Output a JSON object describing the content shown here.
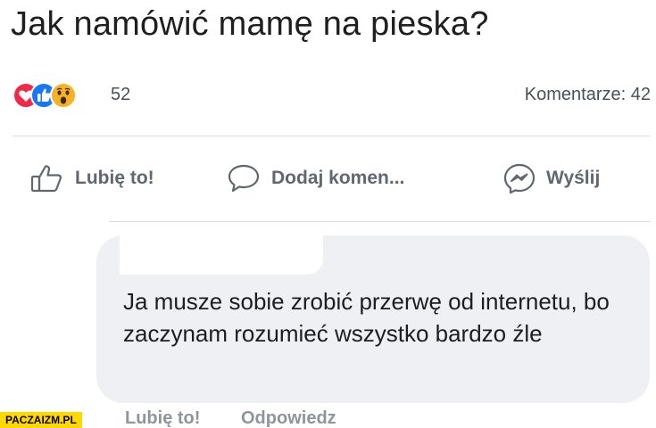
{
  "post": {
    "title": "Jak namówić mamę na pieska?"
  },
  "reactions": {
    "icons": [
      "heart-icon",
      "thumbs-up-icon",
      "wow-icon"
    ],
    "count": "52",
    "comments_label": "Komentarze: 42"
  },
  "actions": {
    "like": "Lubię to!",
    "comment": "Dodaj komen...",
    "send": "Wyślij"
  },
  "comment": {
    "text": "Ja musze sobie zrobić przerwę od internetu, bo zaczynam rozumieć wszystko bardzo źle",
    "like_label": "Lubię to!",
    "reply_label": "Odpowiedz"
  },
  "watermark": {
    "text": "PACZAIZM.PL"
  },
  "colors": {
    "heart": "#f0284a",
    "like_blue": "#1877f2",
    "wow_yellow": "#f7b125",
    "bubble_bg": "#eff0f3",
    "action_text": "#606770",
    "watermark_bg": "#ffd800"
  }
}
